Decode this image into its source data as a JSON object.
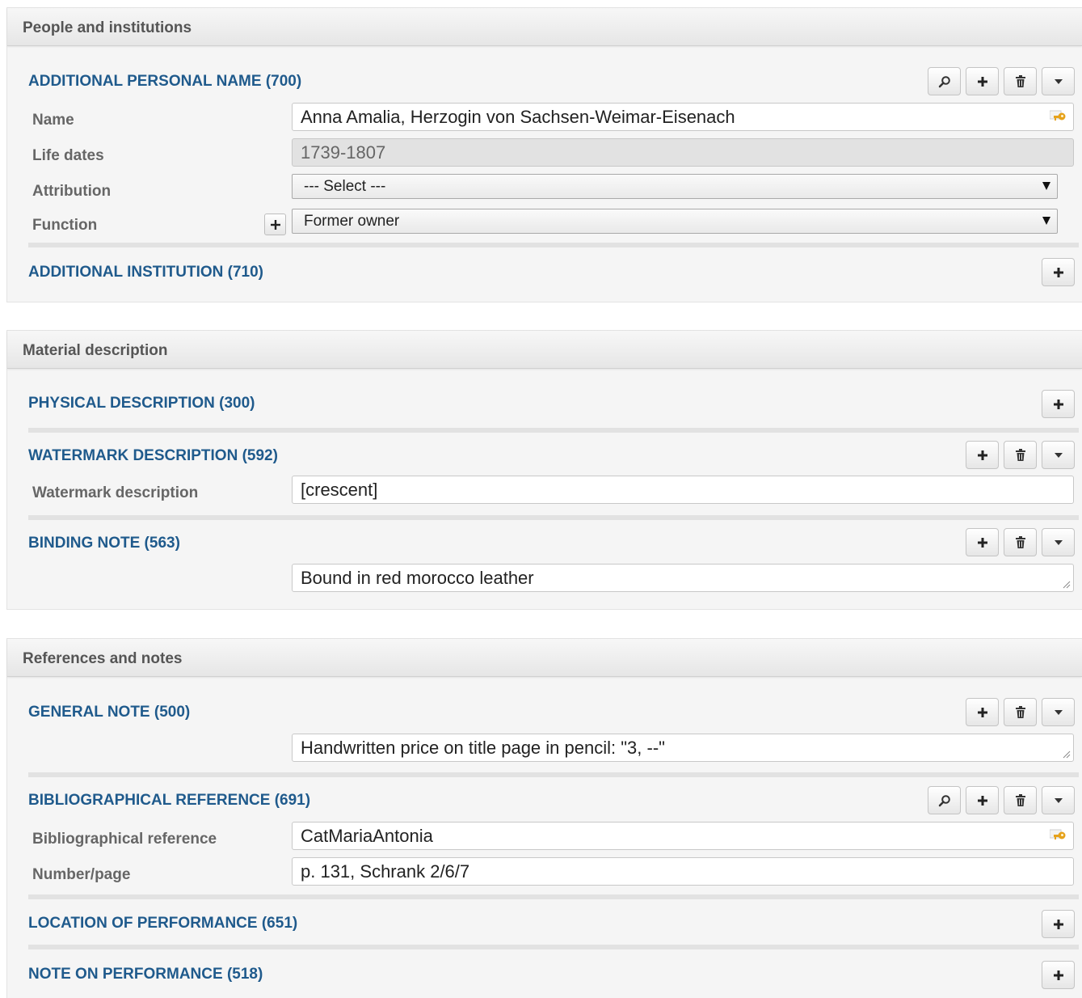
{
  "panels": [
    {
      "title": "People and institutions",
      "sections": {
        "additional_personal_name": {
          "title": "ADDITIONAL PERSONAL NAME (700)",
          "fields": {
            "name": {
              "label": "Name",
              "value": "Anna Amalia, Herzogin von Sachsen-Weimar-Eisenach"
            },
            "life_dates": {
              "label": "Life dates",
              "value": "1739-1807"
            },
            "attribution": {
              "label": "Attribution",
              "selected": "--- Select ---"
            },
            "function": {
              "label": "Function",
              "selected": "Former owner"
            }
          }
        },
        "additional_institution": {
          "title": "ADDITIONAL INSTITUTION (710)"
        }
      }
    },
    {
      "title": "Material description",
      "sections": {
        "physical_description": {
          "title": "PHYSICAL DESCRIPTION (300)"
        },
        "watermark_description": {
          "title": "WATERMARK DESCRIPTION (592)",
          "fields": {
            "watermark": {
              "label": "Watermark description",
              "value": "[crescent]"
            }
          }
        },
        "binding_note": {
          "title": "BINDING NOTE (563)",
          "value": "Bound in red morocco leather"
        }
      }
    },
    {
      "title": "References and notes",
      "sections": {
        "general_note": {
          "title": "GENERAL NOTE (500)",
          "value": "Handwritten price on title page in pencil: \"3, --\""
        },
        "bibliographical_reference": {
          "title": "BIBLIOGRAPHICAL REFERENCE (691)",
          "fields": {
            "reference": {
              "label": "Bibliographical reference",
              "value": "CatMariaAntonia"
            },
            "number_page": {
              "label": "Number/page",
              "value": "p. 131, Schrank 2/6/7"
            }
          }
        },
        "location_of_performance": {
          "title": "LOCATION OF PERFORMANCE (651)"
        },
        "note_on_performance": {
          "title": "NOTE ON PERFORMANCE (518)"
        }
      }
    }
  ],
  "icons": {
    "search": "search-icon",
    "add": "plus-icon",
    "delete": "trash-icon",
    "menu": "caret-down-icon",
    "key": "key-icon"
  },
  "colors": {
    "section_title": "#1f5a8c",
    "panel_title": "#555555",
    "field_label": "#666666",
    "panel_bg": "#f5f5f5"
  }
}
